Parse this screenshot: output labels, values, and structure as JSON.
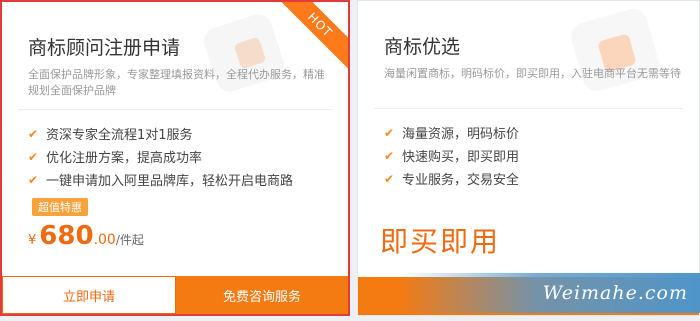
{
  "left_card": {
    "hot_tag": "HOT",
    "title": "商标顾问注册申请",
    "description": "全面保护品牌形象，专家整理填报资料，全程代办服务，精准规划全面保护品牌",
    "features": [
      "资深专家全流程1对1服务",
      "优化注册方案，提高成功率",
      "一键申请加入阿里品牌库，轻松开启电商路"
    ],
    "badge": "超值特惠",
    "price": {
      "currency": "¥",
      "integer": "680",
      "decimal": ".00",
      "unit": "/件起"
    },
    "buttons": {
      "apply": "立即申请",
      "consult": "免费咨询服务"
    }
  },
  "right_card": {
    "title": "商标优选",
    "description": "海量闲置商标，明码标价，即买即用，入驻电商平台无需等待",
    "features": [
      "海量资源，明码标价",
      "快速购买，即买即用",
      "专业服务，交易安全"
    ],
    "cta_text": "即买即用"
  },
  "watermark": "Weimahe.com",
  "colors": {
    "accent": "#f47b12",
    "highlight_border": "#e33b3b",
    "check": "#f28a1f"
  }
}
